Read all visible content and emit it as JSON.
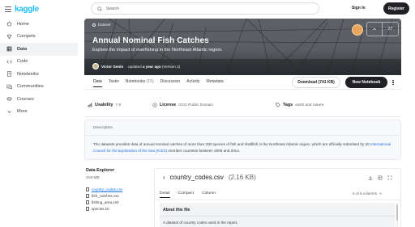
{
  "brand": {
    "logo": "kaggle",
    "color": "#20beff"
  },
  "sidebar": {
    "items": [
      {
        "label": "Home",
        "icon": "home-icon"
      },
      {
        "label": "Compete",
        "icon": "trophy-icon"
      },
      {
        "label": "Data",
        "icon": "table-icon",
        "active": true
      },
      {
        "label": "Code",
        "icon": "code-icon"
      },
      {
        "label": "Notebooks",
        "icon": "notebook-icon"
      },
      {
        "label": "Communities",
        "icon": "comments-icon"
      },
      {
        "label": "Courses",
        "icon": "school-icon"
      },
      {
        "label": "More",
        "icon": "chevron-down-icon"
      }
    ]
  },
  "header": {
    "search_placeholder": "Search",
    "signin": "Sign In",
    "register": "Register"
  },
  "hero": {
    "badge": "Dataset",
    "title": "Annual Nominal Fish Catches",
    "subtitle": "Explore the impact of overfishing in the Northeast Atlantic region.",
    "author": "Victor Genin",
    "updated_prefix": "· updated",
    "updated_time": "a year ago",
    "version": "(Version 2)",
    "votes": "27"
  },
  "tabs": [
    {
      "label": "Data",
      "active": true
    },
    {
      "label": "Tasks"
    },
    {
      "label": "Notebooks",
      "count": "(15)"
    },
    {
      "label": "Discussion"
    },
    {
      "label": "Activity"
    },
    {
      "label": "Metadata"
    }
  ],
  "actions": {
    "download": "Download (741 KB)",
    "new_notebook": "New Notebook"
  },
  "meta": {
    "usability_label": "Usability",
    "usability_value": "7.6",
    "license_label": "License",
    "license_value": "GCD Public Domain",
    "tags_label": "Tags",
    "tags_value": "earth and nature"
  },
  "description": {
    "heading": "Description",
    "text_1": "The datasets provides data of annual nominal catches of more than 200 species of fish and shellfish in the Northeast Atlantic region, which are officially submitted by 20 ",
    "link": "International Council for the Exploration of the Sea (ICES)",
    "text_2": " member countries between 2006 and 2014."
  },
  "explorer": {
    "title": "Data Explorer",
    "size": "418 MB",
    "files": [
      {
        "name": "country_codes.csv",
        "active": true
      },
      {
        "name": "fish_catches.csv"
      },
      {
        "name": "fishing_area.xml"
      },
      {
        "name": "species.txt"
      }
    ]
  },
  "file_panel": {
    "filename": "country_codes.csv",
    "size": "(2.16 KB)",
    "tabs": [
      {
        "label": "Detail",
        "active": true
      },
      {
        "label": "Compact"
      },
      {
        "label": "Column"
      }
    ],
    "columns_info": "6 of 6 columns",
    "about_title": "About this file",
    "about_text": "A dataset of country codes used in the report."
  }
}
